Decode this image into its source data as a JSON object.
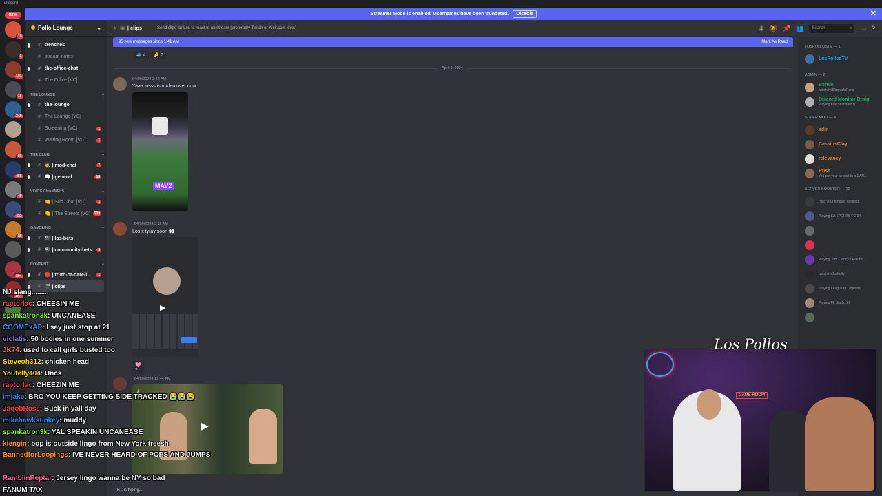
{
  "app": {
    "title": "Discord"
  },
  "banner": {
    "text": "Streamer Mode is enabled. Usernames have been truncated.",
    "disable": "Disable"
  },
  "server_rail": {
    "new_label": "NEW",
    "servers": [
      {
        "color": "#d9533f",
        "badge": "10"
      },
      {
        "color": "#3b2f2a",
        "badge": "1"
      },
      {
        "color": "#8a3d2a",
        "badge": "191"
      },
      {
        "color": "#4b4b55",
        "badge": "16"
      },
      {
        "color": "#2f5f8f",
        "badge": "349"
      },
      {
        "color": "#b0a090",
        "badge": ""
      },
      {
        "color": "#c45a3a",
        "badge": "56"
      },
      {
        "color": "#2a3a6a",
        "badge": "486"
      },
      {
        "color": "#7a7a7a",
        "badge": "49"
      },
      {
        "color": "#3a4a7a",
        "badge": "422"
      },
      {
        "color": "#c47a2a",
        "badge": "88"
      },
      {
        "color": "#5a5a5a",
        "badge": ""
      },
      {
        "color": "#aa3344",
        "badge": "804"
      },
      {
        "color": "#9a2a2a",
        "badge": "3K+"
      },
      {
        "color": "#4a7a3a",
        "badge": ""
      }
    ]
  },
  "sidebar": {
    "server_name": "Pollo Lounge",
    "channels": [
      {
        "type": "channel",
        "name": "trenches",
        "unread": true,
        "badge": ""
      },
      {
        "type": "channel",
        "name": "stream-notes",
        "unread": false,
        "badge": ""
      },
      {
        "type": "channel",
        "name": "the-office-chat",
        "unread": true,
        "badge": ""
      },
      {
        "type": "channel",
        "name": "The Office [VC]",
        "unread": false,
        "badge": ""
      },
      {
        "type": "category",
        "name": "THE LOUNGE"
      },
      {
        "type": "channel",
        "name": "the-lounge",
        "unread": true,
        "badge": ""
      },
      {
        "type": "channel",
        "name": "The Lounge [VC]",
        "unread": false,
        "badge": ""
      },
      {
        "type": "channel",
        "name": "Screening [VC]",
        "unread": false,
        "badge": "1"
      },
      {
        "type": "channel",
        "name": "Waiting Room [VC]",
        "unread": false,
        "badge": "1"
      },
      {
        "type": "category",
        "name": "THE CLUB"
      },
      {
        "type": "channel",
        "name": "🕵️ | mod-chat",
        "unread": true,
        "badge": "7"
      },
      {
        "type": "channel",
        "name": "🗨️ | general",
        "unread": true,
        "badge": "18"
      },
      {
        "type": "category",
        "name": "VOICE CHANNELS"
      },
      {
        "type": "channel",
        "name": "🍋 | Sub Chat [VC]",
        "unread": false,
        "badge": "1"
      },
      {
        "type": "channel",
        "name": "🍋 | The Streets [VC]",
        "unread": false,
        "badge": "108"
      },
      {
        "type": "category",
        "name": "GAMBLING"
      },
      {
        "type": "channel",
        "name": "🎱 | los-bets",
        "unread": true,
        "badge": ""
      },
      {
        "type": "channel",
        "name": "🎱 | community-bets",
        "unread": true,
        "badge": "3"
      },
      {
        "type": "category",
        "name": "CONTENT"
      },
      {
        "type": "channel",
        "name": "🔴 | truth-or-dare-i...",
        "unread": true,
        "badge": "1"
      },
      {
        "type": "channel",
        "name": "🎬 | clips",
        "unread": true,
        "badge": "",
        "active": true
      }
    ]
  },
  "header": {
    "channel": "📼 | clips",
    "topic": "Send clips for Los to react to on stream (preferably Twitch or Kick.com links)",
    "search_placeholder": "Search"
  },
  "new_messages": {
    "text": "95 new messages since 1:41 AM",
    "mark": "Mark As Read"
  },
  "reactions": [
    {
      "emoji": "🧢",
      "count": "4"
    },
    {
      "emoji": "🤌",
      "count": "2"
    }
  ],
  "date_divider": "April 9, 2024",
  "messages": [
    {
      "time": "04/09/2024 2:43 AM",
      "user": "",
      "text": "Yaaa losss is undercover now",
      "media_label": "MAVZ"
    },
    {
      "time": "04/09/2024 3:11 AM",
      "user": "",
      "text": "Los x tyray soon 👀",
      "reaction_count": "2"
    },
    {
      "time": "04/09/2024 12:44 PM",
      "user": "",
      "text": ""
    }
  ],
  "typing": "F... is typing...",
  "member_list": {
    "groups": [
      {
        "title": "LOSPOLLOSTV — 1",
        "members": [
          {
            "name": "LosPollosTV",
            "color": "#00a8fc",
            "status": "",
            "avatar": "#3a6fa8"
          }
        ]
      },
      {
        "title": "ADMIN — 2",
        "members": [
          {
            "name": "Bernie",
            "color": "#23a55a",
            "status": "twitch.tv/SlingazInParis",
            "avatar": "#c9a27e"
          },
          {
            "name": "Discord Monitor Braig",
            "color": "#23a55a",
            "status": "Playing Los Scandaleux",
            "avatar": "#b0b0b0"
          }
        ]
      },
      {
        "title": "SUPER MOD — 4",
        "members": [
          {
            "name": "adin",
            "color": "#e67e22",
            "status": "",
            "avatar": "#5a3a2a"
          },
          {
            "name": "CassiusClay",
            "color": "#e67e22",
            "status": "",
            "avatar": "#7a5a4a"
          },
          {
            "name": "relevancy",
            "color": "#e67e22",
            "status": "",
            "avatar": "#dcdcdc"
          },
          {
            "name": "Russ",
            "color": "#e67e22",
            "status": "You put your aircraft in a DAN...",
            "avatar": "#8a6a5a"
          }
        ]
      },
      {
        "title": "SERVER BOOSTER — 10",
        "members": [
          {
            "name": "",
            "color": "#f47fff",
            "status": "Hold your tongue, stripling.",
            "avatar": "#3a3a3a"
          },
          {
            "name": "",
            "color": "#f47fff",
            "status": "Playing EA SPORTS FC 24",
            "avatar": "#4a5a8a"
          },
          {
            "name": "",
            "color": "#f47fff",
            "status": "",
            "avatar": "#6a6a6a"
          },
          {
            "name": "",
            "color": "#f47fff",
            "status": "",
            "avatar": "#e0305a"
          },
          {
            "name": "",
            "color": "#f47fff",
            "status": "Playing Tom Clancy's Rainbo...",
            "avatar": "#6a3aaa"
          },
          {
            "name": "",
            "color": "#f47fff",
            "status": "twitch.tv/Jaskolty",
            "avatar": "#2a2a2a"
          },
          {
            "name": "",
            "color": "#f47fff",
            "status": "Playing League of Legends",
            "avatar": "#4a4a4a"
          },
          {
            "name": "",
            "color": "#f47fff",
            "status": "Playing FL Studio 21",
            "avatar": "#9a8a7a"
          },
          {
            "name": "",
            "color": "#f47fff",
            "status": "",
            "avatar": "#5a6a5a"
          }
        ]
      }
    ]
  },
  "stream_chat": [
    {
      "user": "",
      "text": "NJ slang.........",
      "color": "#4aa3ff"
    },
    {
      "user": "raptorlac",
      "text": "CHEESIN ME",
      "color": "#ff4040"
    },
    {
      "user": "spankatron3k",
      "text": "UNCANEASE",
      "color": "#7cfc00"
    },
    {
      "user": "CGOMExAP",
      "text": "I say just stop at 21",
      "color": "#1e90ff"
    },
    {
      "user": "violatis",
      "text": "50 bodies in one summer",
      "color": "#9370db"
    },
    {
      "user": "JK74",
      "text": "used to call girls busted too",
      "color": "#ff6347"
    },
    {
      "user": "Steveoh312",
      "text": "chicken head",
      "color": "#ffd700"
    },
    {
      "user": "Youfelly404",
      "text": "Uncs",
      "color": "#ffd700"
    },
    {
      "user": "raptorlac",
      "text": "CHEEZIN ME",
      "color": "#ff4040"
    },
    {
      "user": "imjake",
      "text": "BRO YOU KEEP GETTING SIDE TRACKED 😭😭😭",
      "color": "#1e90ff"
    },
    {
      "user": "JaqobRoss",
      "text": "Buck in yall day",
      "color": "#ff4040"
    },
    {
      "user": "mikehawkstinkey",
      "text": "muddy",
      "color": "#1e90ff"
    },
    {
      "user": "spankatron3k",
      "text": "YAL SPEAKIN UNCANEASE",
      "color": "#7cfc00"
    },
    {
      "user": "kiengin",
      "text": "bop is outside lingo from New York treesh",
      "color": "#ff8c00"
    },
    {
      "user": "BannedforLoopings",
      "text": "IVE NEVER HEARD OF POPS AND JUMPS",
      "color": "#ff8c00"
    },
    {
      "user": "",
      "text": "",
      "color": "#ffffff"
    },
    {
      "user": "RamblinReptar",
      "text": "Jersey lingo wanna be NY so bad",
      "color": "#ff6699"
    },
    {
      "user": "",
      "text": "FANUM TAX",
      "color": "#ff6699"
    }
  ],
  "webcam": {
    "signature": "Los Pollos",
    "neon_sign": "GAME ROOM"
  }
}
